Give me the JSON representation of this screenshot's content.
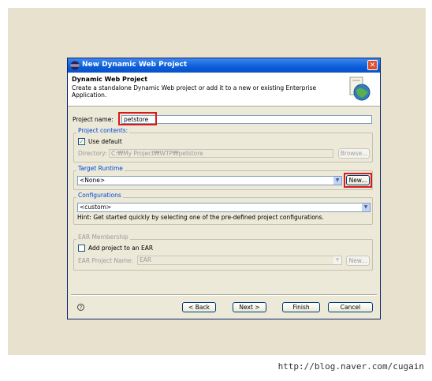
{
  "window": {
    "title": "New Dynamic Web Project",
    "close_glyph": "✕"
  },
  "header": {
    "title": "Dynamic Web Project",
    "description": "Create a standalone Dynamic Web project or add it to a new or existing Enterprise Application."
  },
  "project_name": {
    "label": "Project name:",
    "value": "petstore"
  },
  "project_contents": {
    "group_label": "Project contents:",
    "use_default_label": "Use default",
    "use_default_checked": true,
    "directory_label": "Directory:",
    "directory_value": "C:₩My Project₩WTP₩petstore",
    "browse_label": "Browse..."
  },
  "target_runtime": {
    "group_label": "Target Runtime",
    "selected": "<None>",
    "new_label": "New..."
  },
  "configurations": {
    "group_label": "Configurations",
    "selected": "<custom>",
    "hint": "Hint: Get started quickly by selecting one of the pre-defined project configurations."
  },
  "ear_membership": {
    "group_label": "EAR Membership",
    "add_label": "Add project to an EAR",
    "add_checked": false,
    "ear_name_label": "EAR Project Name:",
    "ear_name_value": "EAR",
    "new_label": "New..."
  },
  "buttons": {
    "back": "< Back",
    "next": "Next >",
    "finish": "Finish",
    "cancel": "Cancel"
  },
  "help_glyph": "?",
  "footer_url": "http://blog.naver.com/cugain",
  "icons": {
    "title": "eclipse-icon",
    "header": "web-project-globe-icon",
    "help": "help-icon",
    "dropdown": "chevron-down-icon"
  },
  "colors": {
    "titlebar": "#0a5ed8",
    "highlight_box": "#d81c1c",
    "group_label": "#0046d5"
  }
}
